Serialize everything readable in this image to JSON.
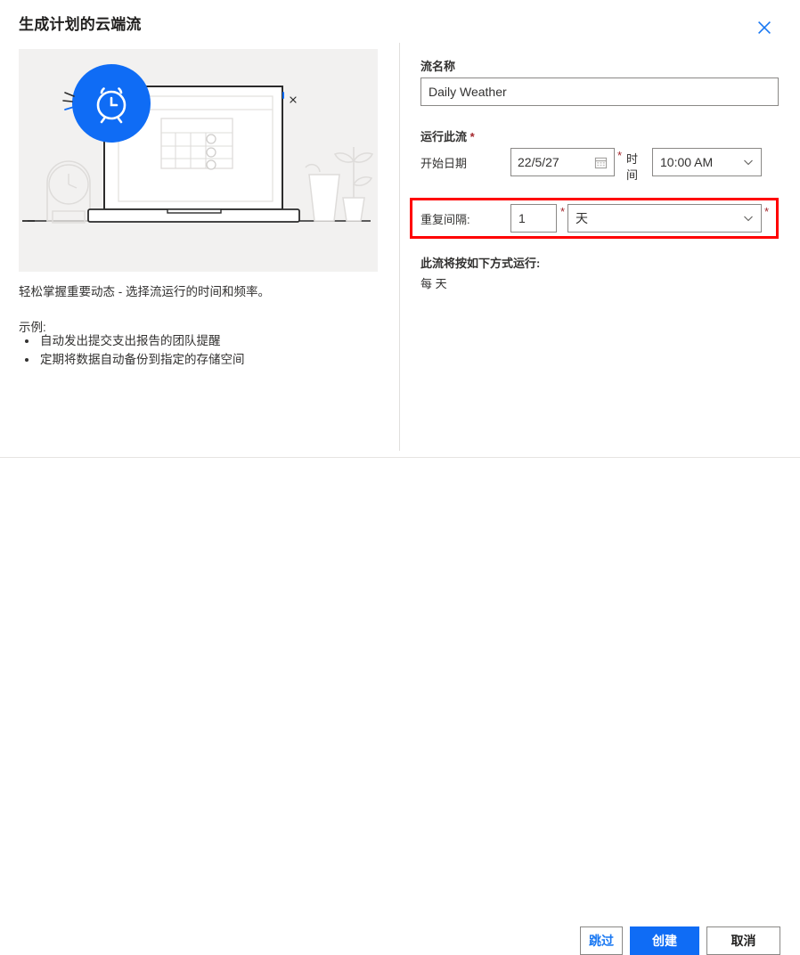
{
  "header": {
    "title": "生成计划的云端流",
    "close_icon": "close-icon"
  },
  "left_panel": {
    "illustration_name": "scheduled-flow-illustration",
    "promo_text": "轻松掌握重要动态 - 选择流运行的时间和频率。",
    "examples_label": "示例:",
    "examples": [
      "自动发出提交支出报告的团队提醒",
      "定期将数据自动备份到指定的存储空间"
    ]
  },
  "form": {
    "flow_name": {
      "label": "流名称",
      "value": "Daily Weather",
      "placeholder": ""
    },
    "run_this_flow": {
      "label": "运行此流",
      "required_mark": "*"
    },
    "start_date": {
      "label": "开始日期",
      "value": "22/5/27",
      "icon": "calendar-icon",
      "required_mark": "*"
    },
    "time": {
      "label": "时间",
      "value": "10:00 AM",
      "icon": "chevron-down-icon"
    },
    "interval": {
      "label": "重复间隔:",
      "number_value": "1",
      "number_required_mark": "*",
      "unit_value": "天",
      "unit_icon": "chevron-down-icon",
      "unit_required_mark": "*",
      "highlight_color": "#ff0000"
    },
    "summary": {
      "title": "此流将按如下方式运行:",
      "value": "每 天"
    }
  },
  "footer": {
    "skip_label": "跳过",
    "create_label": "创建",
    "cancel_label": "取消",
    "accent_color": "#0f6cf5"
  }
}
